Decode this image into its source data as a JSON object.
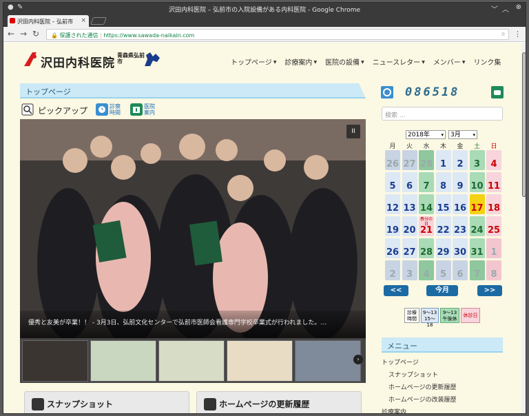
{
  "browser": {
    "window_title": "沢田内科医院 – 弘前市の入院設備がある内科医院 - Google Chrome",
    "tab_title": "沢田内科医院 – 弘前市",
    "secure_label": "保護された通信",
    "url": "https://www.sawada-naikain.com"
  },
  "site": {
    "logo_text": "沢田内科医院",
    "logo_sub": "青森県弘前市",
    "nav": [
      {
        "label": "トップページ",
        "active": true,
        "caret": true
      },
      {
        "label": "診療案内",
        "active": false,
        "caret": true
      },
      {
        "label": "医院の設備",
        "active": false,
        "caret": true
      },
      {
        "label": "ニュースレター",
        "active": false,
        "caret": true
      },
      {
        "label": "メンバー",
        "active": false,
        "caret": true
      },
      {
        "label": "リンク集",
        "active": false,
        "caret": false
      }
    ]
  },
  "main": {
    "section_title": "トップページ",
    "pickup_label": "ピックアップ",
    "pickup_links": [
      {
        "label": "診察時間"
      },
      {
        "label": "医院案内"
      }
    ],
    "slide_caption": "優秀と友美が卒業！！ - 3月3日、弘前文化センターで弘前市医師会看護専門学校卒業式が行われました。…",
    "pause_label": "II",
    "cards": [
      {
        "label": "スナップショット"
      },
      {
        "label": "ホームページの更新履歴"
      }
    ]
  },
  "sidebar": {
    "counter": "086518",
    "search_placeholder": "検索 ...",
    "calendar": {
      "year_select": "2018年",
      "month_select": "3月",
      "weekdays": [
        "月",
        "火",
        "水",
        "木",
        "金",
        "土",
        "日"
      ],
      "weeks": [
        [
          "26",
          "27",
          "28",
          "1",
          "2",
          "3",
          "4"
        ],
        [
          "5",
          "6",
          "7",
          "8",
          "9",
          "10",
          "11"
        ],
        [
          "12",
          "13",
          "14",
          "15",
          "16",
          "17",
          "18"
        ],
        [
          "19",
          "20",
          "21",
          "22",
          "23",
          "24",
          "25"
        ],
        [
          "26",
          "27",
          "28",
          "29",
          "30",
          "31",
          "1"
        ],
        [
          "2",
          "3",
          "4",
          "5",
          "6",
          "7",
          "8"
        ]
      ],
      "holiday_note": "春分の日",
      "prev_label": "<<",
      "today_label": "今月",
      "next_label": ">>"
    },
    "legend": [
      {
        "label": "診療時間"
      },
      {
        "label": "9〜13 15〜18"
      },
      {
        "label": "9〜13 午後休"
      },
      {
        "label": "休診日"
      }
    ],
    "menu_title": "メニュー",
    "menu_items": [
      {
        "label": "トップページ",
        "indent": 0
      },
      {
        "label": "スナップショット",
        "indent": 1
      },
      {
        "label": "ホームページの更新履歴",
        "indent": 1
      },
      {
        "label": "ホームページの改装履歴",
        "indent": 1
      },
      {
        "label": "診療案内",
        "indent": 0
      }
    ]
  },
  "colors": {
    "accent": "#1a6fb8",
    "section_bg": "#cbe9f6",
    "page_bg": "#fbf8e3",
    "cal_past": "#c8d4e4",
    "cal_weekday": "#dde8f5",
    "cal_wed": "#a8dbb6",
    "cal_sat": "#a8dbb6",
    "cal_sun": "#f8d4dc",
    "cal_today": "#f4d312"
  }
}
